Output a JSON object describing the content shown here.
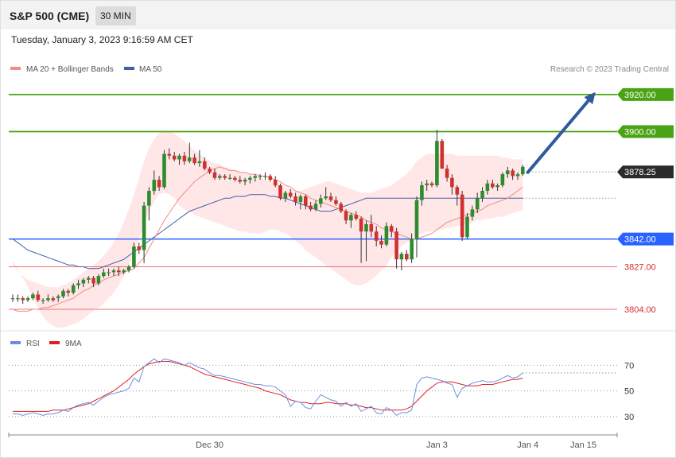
{
  "header": {
    "title": "S&P 500 (CME)",
    "timeframe": "30 MIN"
  },
  "date_text": "Tuesday, January 3, 2023 9:16:59 AM CET",
  "legend": {
    "ma20": "MA 20 + Bollinger Bands",
    "ma50": "MA 50",
    "credit": "Research © 2023 Trading Central"
  },
  "rsi_legend": {
    "rsi": "RSI",
    "ma9": "9MA"
  },
  "colors": {
    "up": "#2e8b2e",
    "down": "#d32f2f",
    "green_level": "#4aa314",
    "blue_level": "#2962ff",
    "red_level": "#e57373",
    "ma20": "#f28b82",
    "ma50": "#3f5fa8",
    "band": "#ffe3e3",
    "arrow": "#2f5a9e",
    "rsi": "#6b8ee0",
    "rsi_ma": "#e02020"
  },
  "chart_data": [
    {
      "type": "candlestick",
      "ylim": [
        3795,
        3932
      ],
      "current_price": 3878.25,
      "levels": [
        {
          "value": 3920.0,
          "label": "3920.00",
          "kind": "green"
        },
        {
          "value": 3900.0,
          "label": "3900.00",
          "kind": "green"
        },
        {
          "value": 3878.25,
          "label": "3878.25",
          "kind": "current"
        },
        {
          "value": 3842.0,
          "label": "3842.00",
          "kind": "blue"
        },
        {
          "value": 3827.0,
          "label": "3827.00",
          "kind": "red"
        },
        {
          "value": 3804.0,
          "label": "3804.00",
          "kind": "red"
        }
      ],
      "x_ticks": [
        {
          "label": "Dec 30",
          "index": 39
        },
        {
          "label": "Jan 3",
          "index": 84
        },
        {
          "label": "Jan 4",
          "index": 102
        },
        {
          "label": "Jan 15",
          "index": 113
        }
      ],
      "candles": [
        [
          3810,
          3812,
          3808,
          3810
        ],
        [
          3810,
          3812,
          3808,
          3810
        ],
        [
          3810,
          3811,
          3807,
          3809
        ],
        [
          3809,
          3811,
          3808,
          3810
        ],
        [
          3810,
          3813,
          3809,
          3812
        ],
        [
          3812,
          3814,
          3808,
          3809
        ],
        [
          3809,
          3810,
          3807,
          3809
        ],
        [
          3809,
          3812,
          3808,
          3810
        ],
        [
          3810,
          3811,
          3808,
          3809
        ],
        [
          3810,
          3812,
          3808,
          3811
        ],
        [
          3811,
          3815,
          3810,
          3814
        ],
        [
          3814,
          3815,
          3811,
          3813
        ],
        [
          3813,
          3818,
          3812,
          3817
        ],
        [
          3817,
          3820,
          3815,
          3818
        ],
        [
          3818,
          3821,
          3816,
          3820
        ],
        [
          3820,
          3822,
          3818,
          3821
        ],
        [
          3821,
          3822,
          3816,
          3818
        ],
        [
          3818,
          3823,
          3817,
          3822
        ],
        [
          3822,
          3826,
          3821,
          3824
        ],
        [
          3824,
          3826,
          3822,
          3824
        ],
        [
          3824,
          3826,
          3822,
          3825
        ],
        [
          3825,
          3827,
          3822,
          3824
        ],
        [
          3824,
          3826,
          3823,
          3825
        ],
        [
          3825,
          3828,
          3824,
          3827
        ],
        [
          3827,
          3840,
          3826,
          3838
        ],
        [
          3838,
          3840,
          3834,
          3836
        ],
        [
          3836,
          3862,
          3829,
          3860
        ],
        [
          3860,
          3870,
          3852,
          3868
        ],
        [
          3868,
          3879,
          3866,
          3874
        ],
        [
          3874,
          3876,
          3868,
          3870
        ],
        [
          3870,
          3890,
          3869,
          3888
        ],
        [
          3888,
          3891,
          3885,
          3887
        ],
        [
          3887,
          3889,
          3884,
          3885
        ],
        [
          3885,
          3888,
          3882,
          3887
        ],
        [
          3887,
          3889,
          3882,
          3884
        ],
        [
          3884,
          3894,
          3883,
          3886
        ],
        [
          3886,
          3888,
          3882,
          3883
        ],
        [
          3883,
          3890,
          3881,
          3884
        ],
        [
          3884,
          3886,
          3879,
          3880
        ],
        [
          3880,
          3881,
          3877,
          3878
        ],
        [
          3878,
          3880,
          3874,
          3875
        ],
        [
          3875,
          3877,
          3874,
          3876
        ],
        [
          3876,
          3877,
          3874,
          3875
        ],
        [
          3875,
          3877,
          3874,
          3875
        ],
        [
          3875,
          3876,
          3873,
          3874
        ],
        [
          3874,
          3876,
          3872,
          3873
        ],
        [
          3873,
          3875,
          3871,
          3874
        ],
        [
          3874,
          3876,
          3872,
          3875
        ],
        [
          3875,
          3877,
          3873,
          3876
        ],
        [
          3876,
          3877,
          3874,
          3876
        ],
        [
          3876,
          3878,
          3874,
          3876
        ],
        [
          3876,
          3877,
          3873,
          3874
        ],
        [
          3874,
          3876,
          3870,
          3871
        ],
        [
          3871,
          3872,
          3863,
          3864
        ],
        [
          3864,
          3868,
          3862,
          3867
        ],
        [
          3867,
          3869,
          3864,
          3865
        ],
        [
          3865,
          3867,
          3860,
          3862
        ],
        [
          3862,
          3866,
          3858,
          3865
        ],
        [
          3865,
          3866,
          3858,
          3860
        ],
        [
          3860,
          3862,
          3857,
          3858
        ],
        [
          3858,
          3863,
          3857,
          3861
        ],
        [
          3861,
          3866,
          3859,
          3864
        ],
        [
          3864,
          3870,
          3863,
          3865
        ],
        [
          3865,
          3867,
          3862,
          3863
        ],
        [
          3863,
          3865,
          3860,
          3861
        ],
        [
          3861,
          3862,
          3856,
          3857
        ],
        [
          3857,
          3858,
          3850,
          3852
        ],
        [
          3852,
          3856,
          3848,
          3855
        ],
        [
          3855,
          3857,
          3852,
          3853
        ],
        [
          3853,
          3854,
          3829,
          3846
        ],
        [
          3846,
          3852,
          3830,
          3850
        ],
        [
          3850,
          3855,
          3843,
          3846
        ],
        [
          3846,
          3849,
          3838,
          3841
        ],
        [
          3841,
          3844,
          3837,
          3839
        ],
        [
          3839,
          3851,
          3838,
          3849
        ],
        [
          3849,
          3850,
          3843,
          3846
        ],
        [
          3846,
          3848,
          3826,
          3831
        ],
        [
          3831,
          3835,
          3825,
          3834
        ],
        [
          3834,
          3836,
          3830,
          3831
        ],
        [
          3831,
          3845,
          3829,
          3842
        ],
        [
          3842,
          3865,
          3832,
          3863
        ],
        [
          3863,
          3873,
          3860,
          3871
        ],
        [
          3871,
          3874,
          3868,
          3872
        ],
        [
          3872,
          3873,
          3870,
          3871
        ],
        [
          3871,
          3901,
          3870,
          3895
        ],
        [
          3895,
          3896,
          3880,
          3880
        ],
        [
          3880,
          3882,
          3873,
          3875
        ],
        [
          3875,
          3877,
          3866,
          3870
        ],
        [
          3870,
          3871,
          3860,
          3866
        ],
        [
          3866,
          3868,
          3841,
          3843
        ],
        [
          3843,
          3856,
          3842,
          3854
        ],
        [
          3854,
          3860,
          3852,
          3858
        ],
        [
          3858,
          3867,
          3856,
          3864
        ],
        [
          3864,
          3870,
          3862,
          3868
        ],
        [
          3868,
          3874,
          3866,
          3872
        ],
        [
          3872,
          3874,
          3869,
          3870
        ],
        [
          3870,
          3872,
          3868,
          3871
        ],
        [
          3871,
          3878,
          3870,
          3877
        ],
        [
          3877,
          3881,
          3875,
          3879
        ],
        [
          3879,
          3880,
          3874,
          3876
        ],
        [
          3876,
          3878,
          3874,
          3877
        ],
        [
          3877,
          3882,
          3876,
          3881
        ]
      ],
      "ma20": [
        3804,
        3803,
        3803,
        3803,
        3804,
        3804,
        3805,
        3805,
        3806,
        3807,
        3808,
        3809,
        3810,
        3812,
        3814,
        3815,
        3817,
        3818,
        3820,
        3821,
        3822,
        3823,
        3824,
        3825,
        3826,
        3829,
        3832,
        3837,
        3842,
        3847,
        3852,
        3856,
        3860,
        3864,
        3867,
        3870,
        3873,
        3875,
        3877,
        3879,
        3880,
        3881,
        3880,
        3879,
        3879,
        3878,
        3878,
        3877,
        3877,
        3876,
        3876,
        3875,
        3874,
        3873,
        3871,
        3870,
        3868,
        3867,
        3866,
        3864,
        3863,
        3862,
        3861,
        3860,
        3859,
        3858,
        3857,
        3856,
        3855,
        3854,
        3852,
        3851,
        3850,
        3848,
        3847,
        3846,
        3845,
        3844,
        3843,
        3842,
        3842,
        3843,
        3844,
        3845,
        3847,
        3849,
        3851,
        3852,
        3853,
        3854,
        3855,
        3856,
        3857,
        3858,
        3860,
        3861,
        3862,
        3863,
        3864,
        3866,
        3868,
        3870
      ],
      "bb_upper": [
        3828,
        3825,
        3822,
        3820,
        3819,
        3818,
        3817,
        3816,
        3816,
        3816,
        3817,
        3818,
        3820,
        3822,
        3824,
        3826,
        3828,
        3830,
        3833,
        3836,
        3840,
        3845,
        3851,
        3858,
        3866,
        3875,
        3884,
        3891,
        3896,
        3899,
        3900,
        3900,
        3899,
        3897,
        3895,
        3892,
        3890,
        3888,
        3886,
        3884,
        3883,
        3882,
        3881,
        3880,
        3879,
        3878,
        3878,
        3877,
        3876,
        3875,
        3874,
        3873,
        3872,
        3871,
        3870,
        3869,
        3868,
        3868,
        3869,
        3870,
        3871,
        3872,
        3873,
        3873,
        3872,
        3871,
        3870,
        3869,
        3868,
        3867,
        3867,
        3867,
        3868,
        3869,
        3870,
        3871,
        3873,
        3875,
        3877,
        3880,
        3884,
        3886,
        3888,
        3888,
        3888,
        3888,
        3888,
        3888,
        3887,
        3887,
        3887,
        3887,
        3887,
        3887,
        3887,
        3887,
        3887,
        3886,
        3886,
        3885,
        3885,
        3885
      ],
      "bb_lower": [
        3830,
        3826,
        3821,
        3816,
        3810,
        3805,
        3800,
        3797,
        3795,
        3794,
        3794,
        3795,
        3796,
        3797,
        3799,
        3801,
        3803,
        3805,
        3807,
        3810,
        3813,
        3817,
        3822,
        3828,
        3835,
        3842,
        3850,
        3857,
        3862,
        3866,
        3867,
        3866,
        3864,
        3860,
        3858,
        3857,
        3855,
        3854,
        3853,
        3852,
        3851,
        3850,
        3849,
        3848,
        3847,
        3846,
        3846,
        3845,
        3845,
        3845,
        3846,
        3847,
        3847,
        3846,
        3845,
        3843,
        3841,
        3839,
        3836,
        3834,
        3832,
        3830,
        3828,
        3826,
        3824,
        3822,
        3820,
        3818,
        3817,
        3817,
        3818,
        3820,
        3822,
        3825,
        3828,
        3832,
        3835,
        3838,
        3840,
        3842,
        3844,
        3845,
        3846,
        3846,
        3847,
        3847,
        3848,
        3848,
        3849,
        3849,
        3850,
        3851,
        3852,
        3852,
        3853,
        3853,
        3854,
        3854,
        3855,
        3856,
        3857,
        3857
      ],
      "ma50": [
        3842,
        3840,
        3838,
        3836,
        3835,
        3834,
        3833,
        3832,
        3831,
        3830,
        3829,
        3828,
        3828,
        3827,
        3827,
        3826,
        3826,
        3826,
        3827,
        3828,
        3829,
        3830,
        3831,
        3833,
        3835,
        3837,
        3839,
        3841,
        3843,
        3845,
        3847,
        3849,
        3851,
        3853,
        3855,
        3857,
        3858,
        3859,
        3860,
        3861,
        3862,
        3863,
        3864,
        3864,
        3865,
        3865,
        3865,
        3866,
        3866,
        3866,
        3866,
        3865,
        3865,
        3864,
        3864,
        3863,
        3862,
        3861,
        3860,
        3859,
        3858,
        3857,
        3857,
        3857,
        3858,
        3859,
        3860,
        3861,
        3862,
        3863,
        3864,
        3864,
        3864,
        3864,
        3864,
        3864,
        3864,
        3864,
        3864,
        3864,
        3864,
        3864,
        3864,
        3864,
        3864,
        3864,
        3864,
        3864,
        3864,
        3864,
        3864,
        3864,
        3864,
        3864,
        3864,
        3864,
        3864,
        3864,
        3864,
        3864,
        3864,
        3864
      ],
      "arrow": {
        "from": {
          "index": 102,
          "value": 3878
        },
        "to": {
          "index": 115,
          "value": 3920
        }
      }
    },
    {
      "type": "line",
      "ylim": [
        20,
        82
      ],
      "y_ticks": [
        70,
        50,
        30
      ],
      "rsi": [
        32,
        32,
        31,
        32,
        33,
        32,
        31,
        32,
        32,
        33,
        35,
        34,
        37,
        39,
        40,
        41,
        39,
        42,
        45,
        47,
        48,
        49,
        50,
        52,
        60,
        57,
        69,
        72,
        75,
        72,
        75,
        74,
        73,
        72,
        70,
        72,
        70,
        68,
        67,
        64,
        62,
        62,
        61,
        60,
        59,
        58,
        57,
        56,
        55,
        55,
        54,
        54,
        53,
        50,
        47,
        38,
        42,
        41,
        37,
        36,
        42,
        47,
        45,
        43,
        42,
        38,
        41,
        38,
        40,
        34,
        36,
        38,
        33,
        32,
        37,
        35,
        31,
        33,
        33,
        35,
        55,
        60,
        61,
        60,
        59,
        58,
        56,
        55,
        45,
        52,
        54,
        56,
        57,
        58,
        57,
        57,
        58,
        60,
        62,
        60,
        61,
        64
      ],
      "ma9": [
        34,
        34,
        34,
        34,
        34,
        34,
        34,
        34,
        35,
        35,
        35,
        36,
        37,
        38,
        39,
        40,
        42,
        44,
        46,
        48,
        50,
        53,
        56,
        59,
        63,
        66,
        69,
        71,
        72,
        73,
        73,
        73,
        72,
        71,
        70,
        69,
        67,
        65,
        63,
        62,
        61,
        60,
        59,
        58,
        57,
        56,
        55,
        54,
        53,
        52,
        50,
        49,
        48,
        47,
        45,
        43,
        42,
        41,
        41,
        40,
        40,
        40,
        41,
        41,
        40,
        40,
        40,
        39,
        39,
        38,
        37,
        37,
        36,
        35,
        35,
        35,
        35,
        35,
        36,
        38,
        42,
        46,
        50,
        53,
        56,
        57,
        57,
        57,
        56,
        55,
        54,
        54,
        54,
        55,
        55,
        55,
        56,
        57,
        58,
        59,
        59,
        60
      ]
    }
  ]
}
